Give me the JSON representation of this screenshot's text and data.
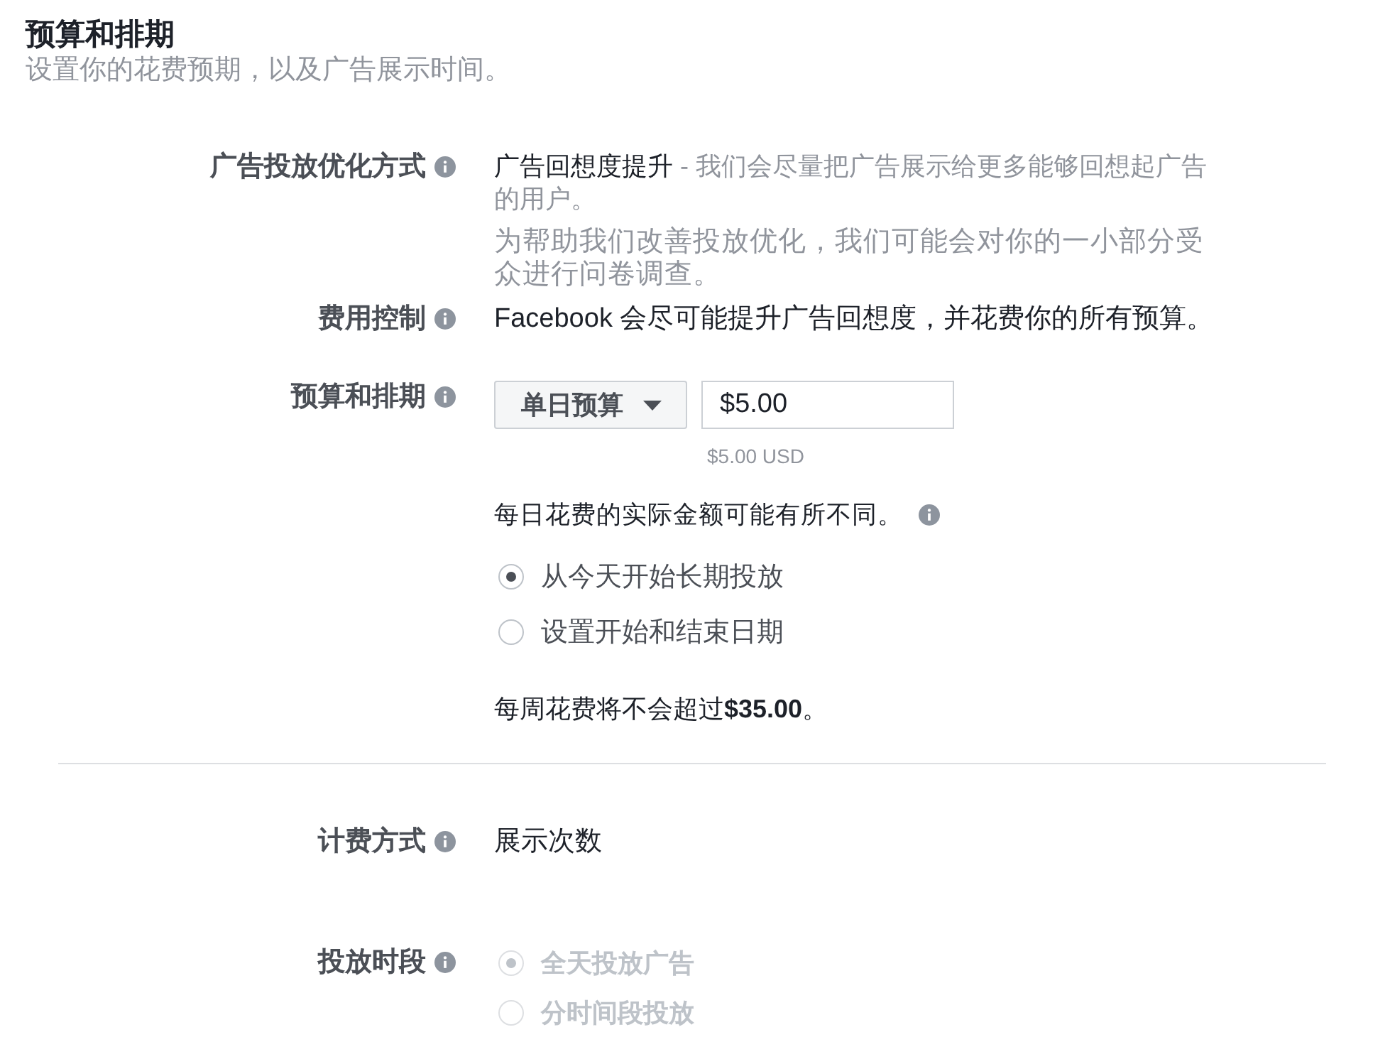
{
  "header": {
    "title": "预算和排期",
    "subtitle": "设置你的花费预期，以及广告展示时间。"
  },
  "groups": [
    {
      "fields": [
        {
          "kind": "optimization",
          "label": "广告投放优化方式",
          "goal": "广告回想度提升",
          "goal_description": "- 我们会尽量把广告展示给更多能够回想起广告的用户。",
          "survey_note": "为帮助我们改善投放优化，我们可能会对你的一小部分受众进行问卷调查。"
        },
        {
          "kind": "text",
          "label": "费用控制",
          "value": "Facebook 会尽可能提升广告回想度，并花费你的所有预算。"
        },
        {
          "kind": "budget",
          "label": "预算和排期",
          "budget_type": "单日预算",
          "amount": "$5.00",
          "amount_hint": "$5.00 USD",
          "note": "每日花费的实际金额可能有所不同。",
          "options": [
            {
              "label": "从今天开始长期投放",
              "selected": true,
              "disabled": false
            },
            {
              "label": "设置开始和结束日期",
              "selected": false,
              "disabled": false
            }
          ],
          "weekly_cap": "每周花费将不会超过**$35.00**。"
        }
      ]
    },
    {
      "fields": [
        {
          "kind": "text",
          "label": "计费方式",
          "value": "展示次数"
        },
        {
          "kind": "options",
          "label": "投放时段",
          "options": [
            {
              "label": "全天投放广告",
              "selected": true,
              "disabled": true
            },
            {
              "label": "分时间段投放",
              "selected": false,
              "disabled": true
            }
          ]
        }
      ]
    }
  ]
}
